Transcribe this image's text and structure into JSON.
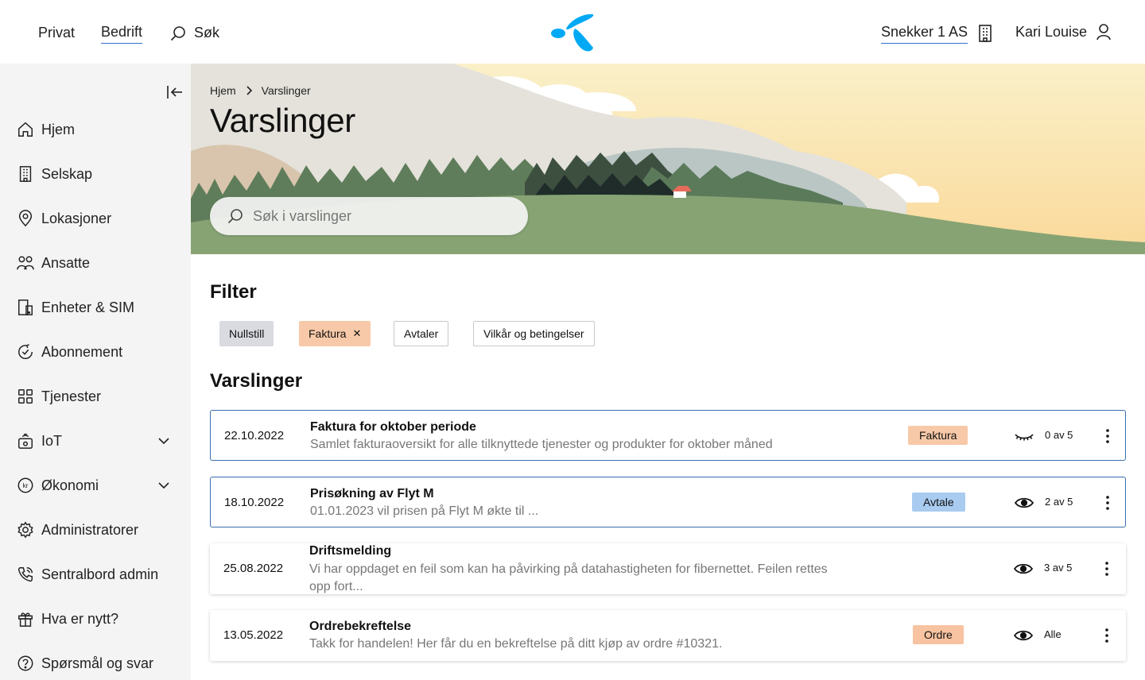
{
  "topbar": {
    "nav": [
      "Privat",
      "Bedrift"
    ],
    "active_index": 1,
    "search_label": "Søk",
    "company": "Snekker 1 AS",
    "user": "Kari Louise",
    "brand_color": "#00a9f4"
  },
  "sidebar": {
    "items": [
      {
        "label": "Hjem",
        "icon": "home-icon"
      },
      {
        "label": "Selskap",
        "icon": "building-icon"
      },
      {
        "label": "Lokasjoner",
        "icon": "location-pin-icon"
      },
      {
        "label": "Ansatte",
        "icon": "people-icon"
      },
      {
        "label": "Enheter & SIM",
        "icon": "devices-icon"
      },
      {
        "label": "Abonnement",
        "icon": "subscription-icon"
      },
      {
        "label": "Tjenester",
        "icon": "grid-icon"
      },
      {
        "label": "IoT",
        "icon": "iot-icon",
        "expandable": true
      },
      {
        "label": "Økonomi",
        "icon": "kroner-icon",
        "expandable": true
      },
      {
        "label": "Administratorer",
        "icon": "gear-icon"
      },
      {
        "label": "Sentralbord admin",
        "icon": "phone-icon"
      },
      {
        "label": "Hva er nytt?",
        "icon": "gift-icon"
      },
      {
        "label": "Spørsmål og svar",
        "icon": "question-icon"
      }
    ]
  },
  "hero": {
    "breadcrumb": [
      "Hjem",
      "Varslinger"
    ],
    "title": "Varslinger",
    "search_placeholder": "Søk i varslinger"
  },
  "filter": {
    "heading": "Filter",
    "reset_label": "Nullstill",
    "active": "Faktura",
    "options": [
      "Avtaler",
      "Vilkår og betingelser"
    ]
  },
  "notifications": {
    "heading": "Varslinger",
    "items": [
      {
        "date": "22.10.2022",
        "title": "Faktura for oktober periode",
        "desc": "Samlet fakturaoversikt for alle tilknyttede tjenester og produkter for oktober måned",
        "tag": "Faktura",
        "tag_kind": "faktura",
        "read_count": "0 av 5",
        "unread": true,
        "eye": "eye-closed-icon"
      },
      {
        "date": "18.10.2022",
        "title": "Prisøkning av Flyt M",
        "desc": "01.01.2023 vil prisen på Flyt M økte til ...",
        "tag": "Avtale",
        "tag_kind": "avtale",
        "read_count": "2 av 5",
        "unread": true,
        "eye": "eye-icon"
      },
      {
        "date": "25.08.2022",
        "title": "Driftsmelding",
        "desc": "Vi har oppdaget en feil som kan ha påvirking på datahastigheten for fibernettet. Feilen rettes opp fort...",
        "tag": "",
        "tag_kind": "",
        "read_count": "3 av 5",
        "unread": false,
        "eye": "eye-icon"
      },
      {
        "date": "13.05.2022",
        "title": "Ordrebekreftelse",
        "desc": "Takk for handelen! Her får du en bekreftelse på ditt kjøp av ordre #10321.",
        "tag": "Ordre",
        "tag_kind": "ordre",
        "read_count": "Alle",
        "unread": false,
        "eye": "eye-icon"
      }
    ]
  }
}
